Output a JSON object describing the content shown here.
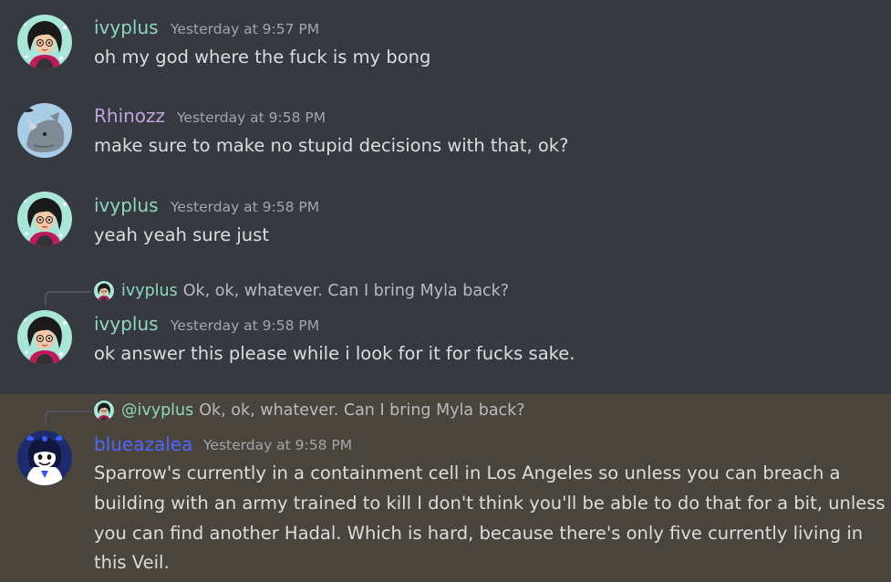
{
  "colors": {
    "background": "#36393f",
    "mention_highlight": "#49443c",
    "ivyplus": "#8fd8c0",
    "rhinozz": "#c1a3e0",
    "blueazalea": "#4e66ff",
    "text": "#dcddde",
    "timestamp": "#a3a6aa"
  },
  "messages": [
    {
      "author": "ivyplus",
      "timestamp": "Yesterday at 9:57 PM",
      "text": "oh my god where the fuck is my bong"
    },
    {
      "author": "Rhinozz",
      "timestamp": "Yesterday at 9:58 PM",
      "text": "make sure to make no stupid decisions with that, ok?"
    },
    {
      "author": "ivyplus",
      "timestamp": "Yesterday at 9:58 PM",
      "text": "yeah yeah sure just"
    },
    {
      "reply": {
        "author": "ivyplus",
        "text": "Ok, ok, whatever. Can I bring Myla back?"
      },
      "author": "ivyplus",
      "timestamp": "Yesterday at 9:58 PM",
      "text": "ok answer this please while i look for it for fucks sake."
    },
    {
      "reply": {
        "author": "@ivyplus",
        "text": "Ok, ok, whatever. Can I bring Myla back?"
      },
      "author": "blueazalea",
      "timestamp": "Yesterday at 9:58 PM",
      "lines": [
        "Sparrow's currently in a containment cell in Los Angeles so unless you can breach a",
        "building with an army trained to kill I don't think you'll be able to do that for a bit, unless",
        "you can find another Hadal. Which is hard, because there's only five currently living in",
        "this Veil."
      ]
    }
  ],
  "icons": {
    "ivyplus_avatar": "girl-dark-curly-hair-teal-background",
    "rhinozz_avatar": "rhino-blue-background",
    "blueazalea_avatar": "bow-girl-navy-background"
  }
}
